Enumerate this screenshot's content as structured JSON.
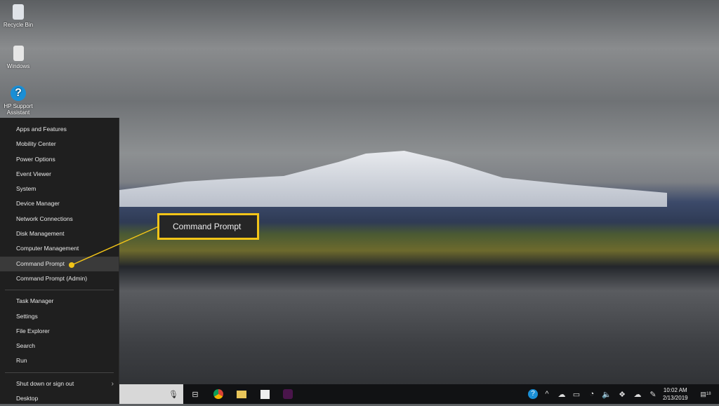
{
  "desktop": {
    "icons": [
      {
        "label": "Recycle Bin",
        "icon": "recycle-bin-icon"
      },
      {
        "label": "Windows",
        "icon": "file-icon"
      },
      {
        "label": "HP Support Assistant",
        "icon": "help-icon"
      }
    ]
  },
  "menu": {
    "groups": [
      [
        "Apps and Features",
        "Mobility Center",
        "Power Options",
        "Event Viewer",
        "System",
        "Device Manager",
        "Network Connections",
        "Disk Management",
        "Computer Management",
        "Command Prompt",
        "Command Prompt (Admin)"
      ],
      [
        "Task Manager",
        "Settings",
        "File Explorer",
        "Search",
        "Run"
      ],
      [
        "Shut down or sign out",
        "Desktop"
      ]
    ],
    "highlighted": "Command Prompt"
  },
  "callout": {
    "label": "Command Prompt",
    "color": "#f2c418"
  },
  "taskbar": {
    "apps": [
      "task-view-icon",
      "chrome-icon",
      "file-explorer-icon",
      "store-icon",
      "slack-icon"
    ],
    "tray": [
      "hp-support-icon",
      "chevron-up-icon",
      "onedrive-icon",
      "battery-icon",
      "wifi-icon",
      "volume-icon",
      "dropbox-icon",
      "cloud-upload-icon",
      "pen-icon"
    ],
    "time": "10:02 AM",
    "date": "2/13/2019",
    "notifications": "18"
  }
}
